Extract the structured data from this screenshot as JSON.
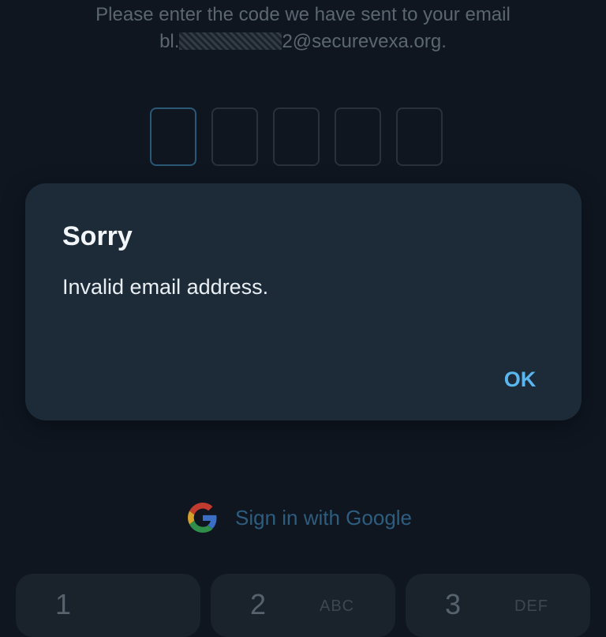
{
  "verify": {
    "prompt_line1": "Please enter the code we have sent to your email",
    "email_prefix": "bl.",
    "email_suffix": "2@securevexa.org."
  },
  "code_boxes": [
    "",
    "",
    "",
    "",
    ""
  ],
  "dialog": {
    "title": "Sorry",
    "message": "Invalid email address.",
    "ok_label": "OK"
  },
  "google_signin": {
    "label": "Sign in with Google",
    "icon": "google-g-icon"
  },
  "keypad": {
    "keys": [
      {
        "num": "1",
        "letters": ""
      },
      {
        "num": "2",
        "letters": "ABC"
      },
      {
        "num": "3",
        "letters": "DEF"
      }
    ]
  },
  "colors": {
    "background": "#0f1620",
    "dialog": "#1d2b38",
    "accent": "#5ab6ef"
  }
}
